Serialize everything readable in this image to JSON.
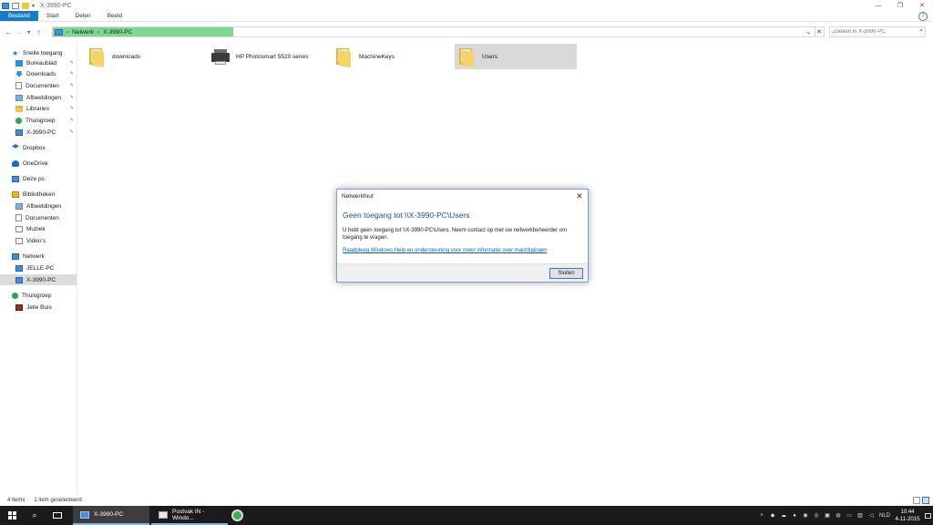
{
  "window": {
    "title": "X-3990-PC",
    "controls": [
      "—",
      "❐",
      "✕"
    ]
  },
  "ribbon": {
    "tabs": [
      "Bestand",
      "Start",
      "Delen",
      "Beeld"
    ],
    "help": "?"
  },
  "address": {
    "crumbs": [
      "Netwerk",
      "X-3990-PC"
    ],
    "search_placeholder": "Zoeken in X-3990-PC"
  },
  "sidebar": {
    "items": [
      {
        "label": "Snelle toegang",
        "icon": "star-icon",
        "pinned": false
      },
      {
        "label": "Bureaublad",
        "icon": "desktop-icon",
        "pinned": true
      },
      {
        "label": "Downloads",
        "icon": "download-icon",
        "pinned": true
      },
      {
        "label": "Documenten",
        "icon": "document-icon",
        "pinned": true
      },
      {
        "label": "Afbeeldingen",
        "icon": "pictures-icon",
        "pinned": true
      },
      {
        "label": "Libraries",
        "icon": "folder-icon",
        "pinned": true
      },
      {
        "label": "Thuisgroep",
        "icon": "homegroup-icon",
        "pinned": true
      },
      {
        "label": "X-3990-PC",
        "icon": "computer-icon",
        "pinned": true
      },
      {
        "label": "Dropbox",
        "icon": "dropbox-icon",
        "pinned": false
      },
      {
        "label": "OneDrive",
        "icon": "onedrive-icon",
        "pinned": false
      },
      {
        "label": "Deze pc",
        "icon": "computer-icon",
        "pinned": false
      },
      {
        "label": "Bibliotheken",
        "icon": "library-icon",
        "pinned": false
      },
      {
        "label": "Afbeeldingen",
        "icon": "pictures-icon",
        "pinned": false
      },
      {
        "label": "Documenten",
        "icon": "document-icon",
        "pinned": false
      },
      {
        "label": "Muziek",
        "icon": "music-icon",
        "pinned": false
      },
      {
        "label": "Video's",
        "icon": "video-icon",
        "pinned": false
      },
      {
        "label": "Netwerk",
        "icon": "network-icon",
        "pinned": false
      },
      {
        "label": "JELLE-PC",
        "icon": "computer-icon",
        "pinned": false
      },
      {
        "label": "X-3990-PC",
        "icon": "computer-icon",
        "pinned": false,
        "selected": true
      },
      {
        "label": "Thuisgroep",
        "icon": "homegroup-icon",
        "pinned": false
      },
      {
        "label": "Jelle Buis",
        "icon": "user-icon",
        "pinned": false
      }
    ]
  },
  "content": {
    "tiles": [
      {
        "label": "downloads",
        "icon": "shared-folder-icon"
      },
      {
        "label": "HP Photosmart 5520 series",
        "icon": "printer-icon"
      },
      {
        "label": "MachineKeys",
        "icon": "shared-folder-icon"
      },
      {
        "label": "Users",
        "icon": "shared-folder-icon",
        "selected": true
      }
    ]
  },
  "dialog": {
    "title": "Netwerkfout",
    "heading": "Geen toegang tot \\\\X-3990-PC\\Users",
    "message": "U hebt geen toegang tot \\\\X-3990-PC\\Users. Neem contact op met uw netwerkbeheerder om toegang te vragen.",
    "link": "Raadpleeg Windows Help en ondersteuning voor meer informatie over machtigingen",
    "button": "Sluiten"
  },
  "status": {
    "count": "4 items",
    "selection": "1 item geselecteerd"
  },
  "taskbar": {
    "apps": [
      {
        "label": "X-3990-PC",
        "icon": "file-explorer-icon",
        "active": true
      },
      {
        "label": "Postvak IN - Windo...",
        "icon": "mail-icon",
        "active": false
      }
    ],
    "language": "NLD",
    "time": "10:44",
    "date": "4-11-2015"
  },
  "colors": {
    "accent": "#1979ca",
    "address_highlight": "#7ed98e",
    "dialog_heading": "#1f4fa8",
    "link": "#0b63c5",
    "taskbar": "#1b1b1b"
  }
}
